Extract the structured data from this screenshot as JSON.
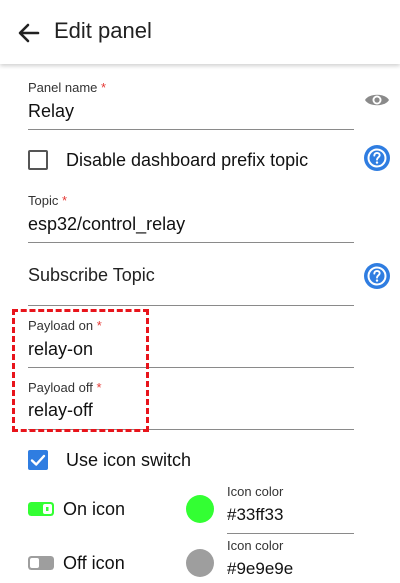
{
  "appbar": {
    "title": "Edit panel",
    "back_icon": "arrow-left-icon"
  },
  "form": {
    "panel_name": {
      "label": "Panel name",
      "required_mark": "*",
      "value": "Relay"
    },
    "disable_prefix": {
      "label": "Disable dashboard prefix topic",
      "checked": false
    },
    "topic": {
      "label": "Topic",
      "required_mark": "*",
      "value": "esp32/control_relay"
    },
    "subscribe_topic": {
      "placeholder": "Subscribe Topic"
    },
    "payload_on": {
      "label": "Payload on",
      "required_mark": "*",
      "value": "relay-on"
    },
    "payload_off": {
      "label": "Payload off",
      "required_mark": "*",
      "value": "relay-off"
    },
    "use_icon_switch": {
      "label": "Use icon switch",
      "checked": true
    },
    "on_icon": {
      "label": "On icon",
      "color_label": "Icon color",
      "color_value": "#33ff33"
    },
    "off_icon": {
      "label": "Off icon",
      "color_label": "Icon color",
      "color_value": "#9e9e9e"
    }
  },
  "colors": {
    "accent": "#2f7de1",
    "required": "#e53935",
    "annotation_box": "#e8141b",
    "on_color": "#33ff33",
    "off_color": "#9e9e9e"
  },
  "icons": [
    "arrow-left-icon",
    "eye-icon",
    "help-icon",
    "toggle-on-icon",
    "toggle-off-icon",
    "checkmark-icon"
  ]
}
